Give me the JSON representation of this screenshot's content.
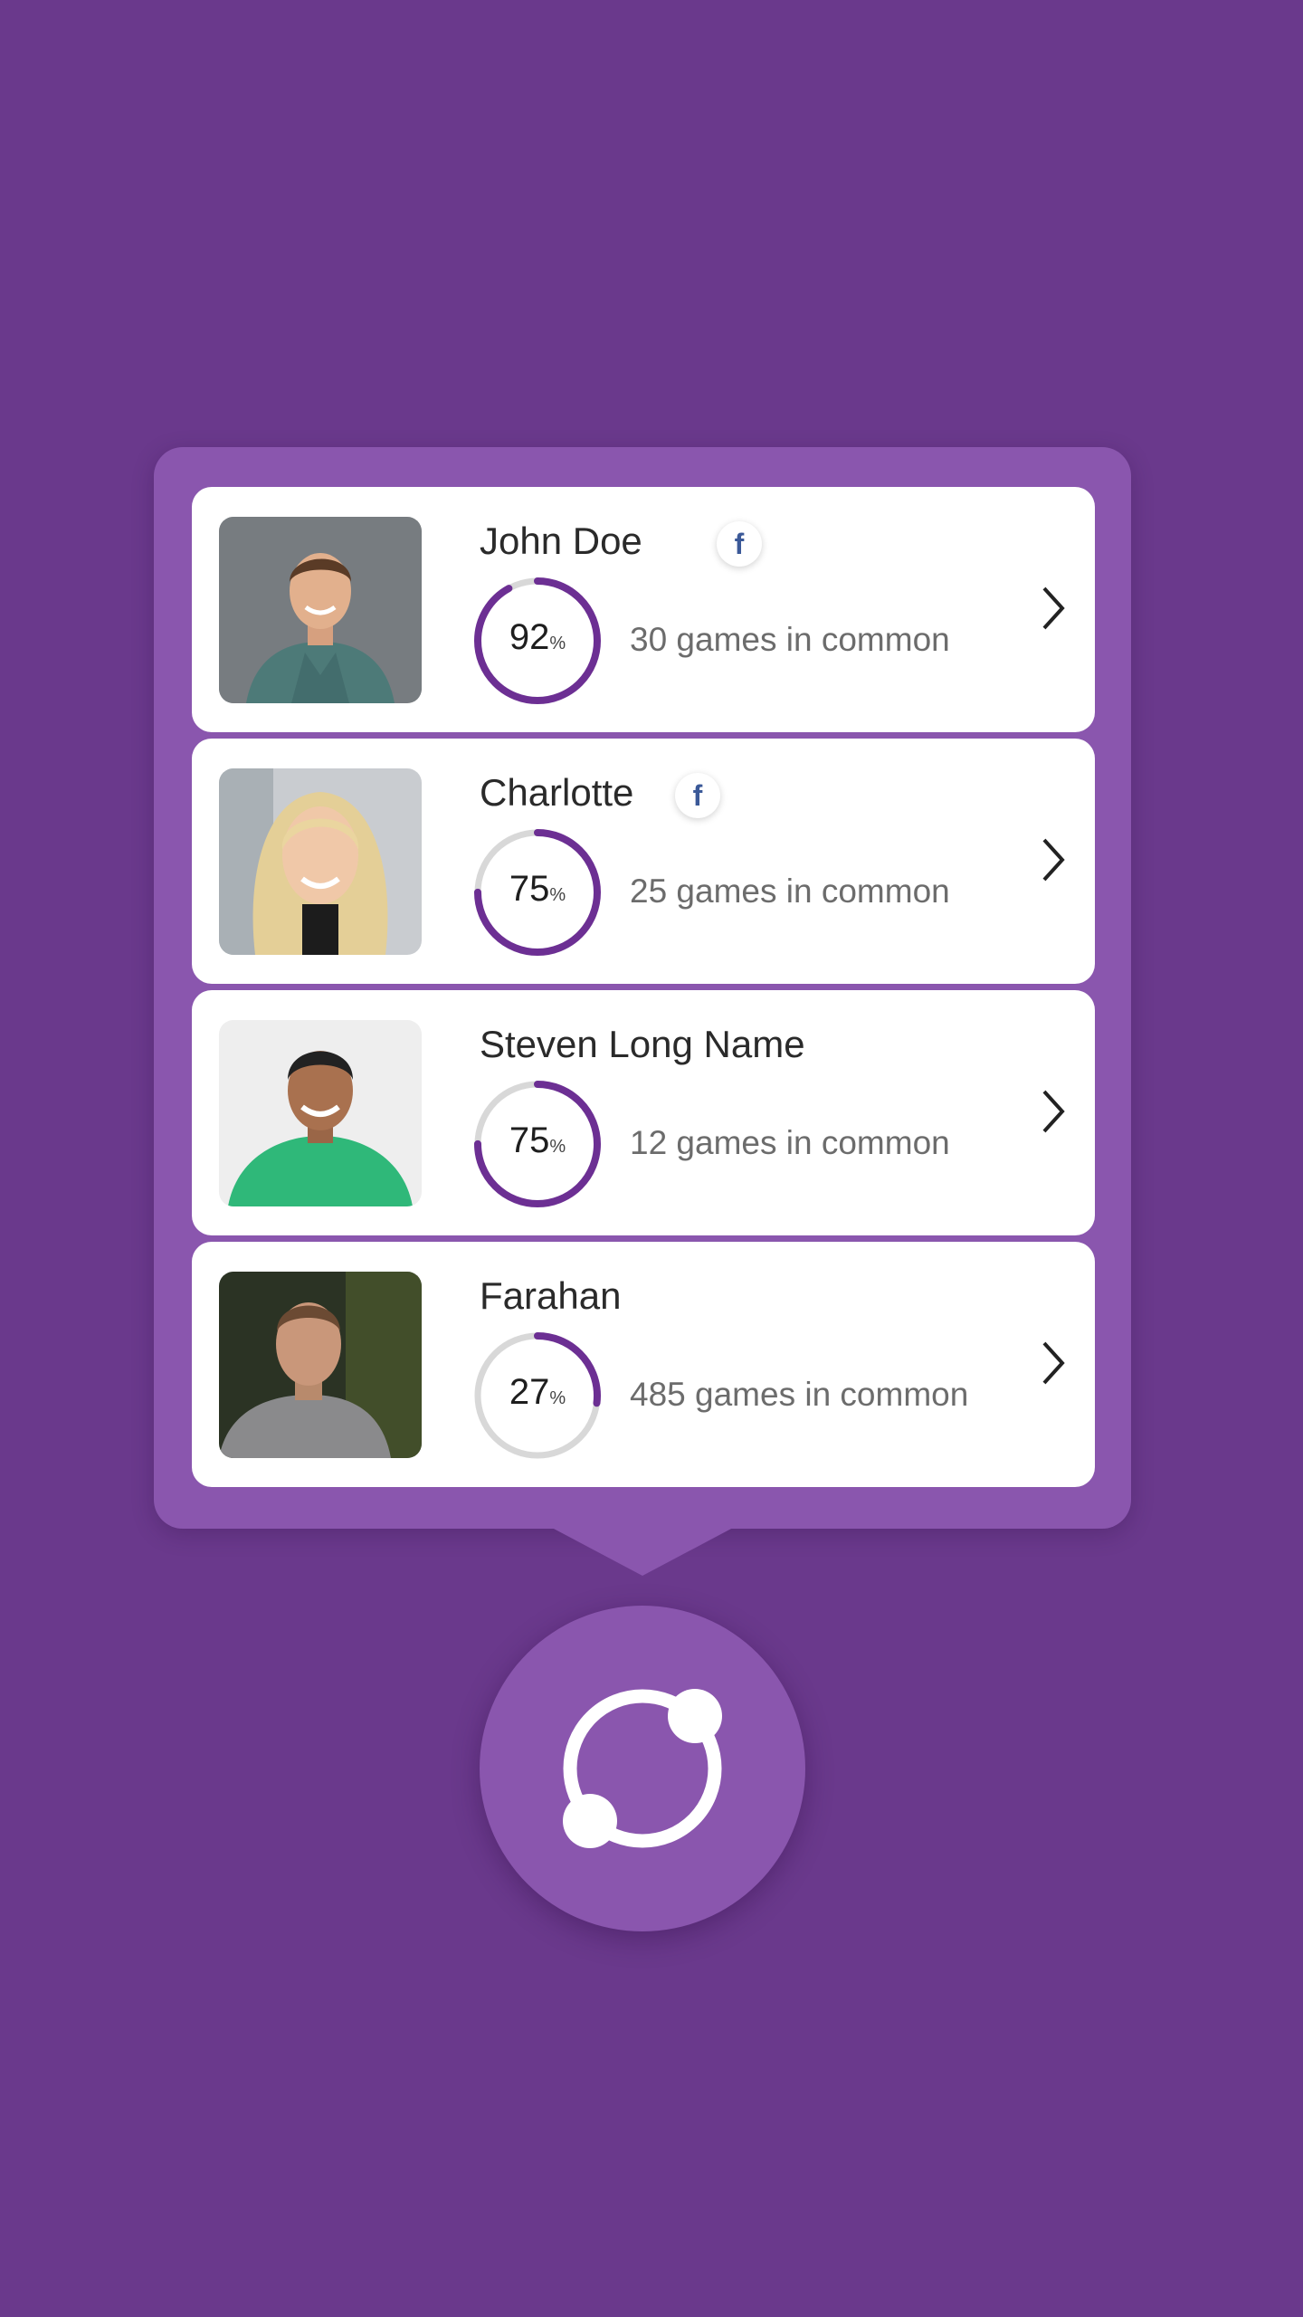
{
  "colors": {
    "background": "#6a398c",
    "panel": "#8a56ae",
    "accent": "#6c2f93",
    "ring_track": "#d8d8d8",
    "facebook": "#3b5998"
  },
  "friends": [
    {
      "name": "John Doe",
      "has_facebook": true,
      "match_percent": 92,
      "percent_label": "92",
      "games_label": "30 games in common",
      "avatar_icon": "person-photo-icon"
    },
    {
      "name": "Charlotte",
      "has_facebook": true,
      "match_percent": 75,
      "percent_label": "75",
      "games_label": "25 games in common",
      "avatar_icon": "person-photo-icon"
    },
    {
      "name": "Steven Long Name",
      "has_facebook": false,
      "match_percent": 75,
      "percent_label": "75",
      "games_label": "12 games in common",
      "avatar_icon": "person-photo-icon"
    },
    {
      "name": "Farahan",
      "has_facebook": false,
      "match_percent": 27,
      "percent_label": "27",
      "games_label": "485 games in common",
      "avatar_icon": "person-photo-icon"
    }
  ],
  "labels": {
    "percent_unit": "%",
    "facebook_glyph": "f"
  },
  "sync_button": {
    "icon": "sync-orbit-icon"
  },
  "chevron_icon": "chevron-right-icon"
}
